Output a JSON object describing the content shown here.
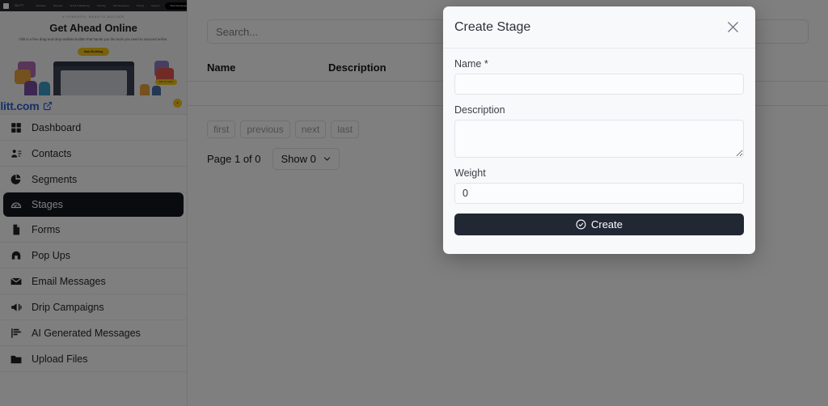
{
  "promo": {
    "logo_text": "OLITT",
    "nav": [
      "Websites",
      "Domains",
      "Email & Marketing",
      "Security",
      "Hire Developer",
      "Pricing",
      "Support"
    ],
    "cta": "Start Developer",
    "eyebrow": "A POWERFUL WEBSITE BUILDER",
    "title": "Get Ahead Online",
    "subtitle": "Olitt is a free drag-and-drop website builder that hands you the tools you need to succeed online.",
    "button": "Start Building",
    "pill": "ADD TO CART",
    "fab": "•",
    "link": "olitt.com"
  },
  "sidebar": {
    "items": [
      {
        "label": "Dashboard",
        "icon": "grid-icon",
        "active": false
      },
      {
        "label": "Contacts",
        "icon": "contacts-icon",
        "active": false
      },
      {
        "label": "Segments",
        "icon": "pie-chart-icon",
        "active": false
      },
      {
        "label": "Stages",
        "icon": "gauge-icon",
        "active": true
      },
      {
        "label": "Forms",
        "icon": "document-icon",
        "active": false
      },
      {
        "label": "Pop Ups",
        "icon": "popup-icon",
        "active": false
      },
      {
        "label": "Email Messages",
        "icon": "envelope-icon",
        "active": false
      },
      {
        "label": "Drip Campaigns",
        "icon": "megaphone-icon",
        "active": false
      },
      {
        "label": "AI Generated Messages",
        "icon": "ai-flag-icon",
        "active": false
      },
      {
        "label": "Upload Files",
        "icon": "folder-icon",
        "active": false
      }
    ]
  },
  "main": {
    "search": {
      "placeholder": "Search...",
      "value": ""
    },
    "table": {
      "columns": [
        "Name",
        "Description"
      ],
      "rows": []
    },
    "pagination": {
      "first": "first",
      "previous": "previous",
      "next": "next",
      "last": "last",
      "page_info": "Page 1 of 0",
      "show_label": "Show 0"
    }
  },
  "modal": {
    "title": "Create Stage",
    "close_label": "×",
    "fields": {
      "name": {
        "label": "Name *",
        "value": "",
        "placeholder": ""
      },
      "description": {
        "label": "Description",
        "value": "",
        "placeholder": ""
      },
      "weight": {
        "label": "Weight",
        "value": "0",
        "placeholder": "0"
      }
    },
    "submit": "Create"
  },
  "colors": {
    "accent_dark": "#212733",
    "sidebar_active": "#15171c",
    "promo_yellow": "#f5c518",
    "link_blue": "#2f5fd0",
    "scrim": "rgba(0,0,0,0.5)"
  }
}
